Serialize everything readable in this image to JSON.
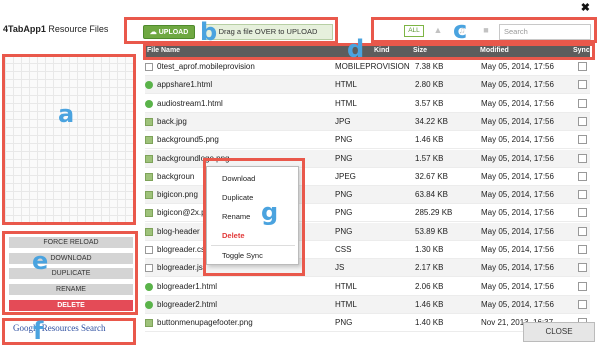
{
  "window": {
    "app_name": "4TabApp1",
    "title_suffix": "Resource Files",
    "close_glyph": "✖"
  },
  "upload": {
    "button_label": "UPLOAD",
    "drop_label": "Drag a file OVER to UPLOAD"
  },
  "filters": {
    "all_label": "ALL",
    "search_placeholder": "Search"
  },
  "table": {
    "columns": {
      "name": "File Name",
      "kind": "Kind",
      "size": "Size",
      "modified": "Modified",
      "sync": "Sync"
    },
    "rows": [
      {
        "icon": "doc",
        "name": "0test_aprof.mobileprovision",
        "kind": "MOBILEPROVISION",
        "size": "7.38 KB",
        "modified": "May 05, 2014, 17:56"
      },
      {
        "icon": "green",
        "name": "appshare1.html",
        "kind": "HTML",
        "size": "2.80 KB",
        "modified": "May 05, 2014, 17:56"
      },
      {
        "icon": "green",
        "name": "audiostream1.html",
        "kind": "HTML",
        "size": "3.57 KB",
        "modified": "May 05, 2014, 17:56"
      },
      {
        "icon": "img",
        "name": "back.jpg",
        "kind": "JPG",
        "size": "34.22 KB",
        "modified": "May 05, 2014, 17:56"
      },
      {
        "icon": "img",
        "name": "background5.png",
        "kind": "PNG",
        "size": "1.46 KB",
        "modified": "May 05, 2014, 17:56"
      },
      {
        "icon": "img",
        "name": "backgroundlogo.png",
        "kind": "PNG",
        "size": "1.57 KB",
        "modified": "May 05, 2014, 17:56"
      },
      {
        "icon": "img",
        "name": "backgroun",
        "kind": "JPEG",
        "size": "32.67 KB",
        "modified": "May 05, 2014, 17:56"
      },
      {
        "icon": "img",
        "name": "bigicon.png",
        "kind": "PNG",
        "size": "63.84 KB",
        "modified": "May 05, 2014, 17:56"
      },
      {
        "icon": "img",
        "name": "bigicon@2x.p",
        "kind": "PNG",
        "size": "285.29 KB",
        "modified": "May 05, 2014, 17:56"
      },
      {
        "icon": "img",
        "name": "blog-header",
        "kind": "PNG",
        "size": "53.89 KB",
        "modified": "May 05, 2014, 17:56"
      },
      {
        "icon": "doc",
        "name": "blogreader.cs",
        "kind": "CSS",
        "size": "1.30 KB",
        "modified": "May 05, 2014, 17:56"
      },
      {
        "icon": "doc",
        "name": "blogreader.js",
        "kind": "JS",
        "size": "2.17 KB",
        "modified": "May 05, 2014, 17:56"
      },
      {
        "icon": "green",
        "name": "blogreader1.html",
        "kind": "HTML",
        "size": "2.06 KB",
        "modified": "May 05, 2014, 17:56"
      },
      {
        "icon": "green",
        "name": "blogreader2.html",
        "kind": "HTML",
        "size": "1.46 KB",
        "modified": "May 05, 2014, 17:56"
      },
      {
        "icon": "img",
        "name": "buttonmenupagefooter.png",
        "kind": "PNG",
        "size": "1.40 KB",
        "modified": "Nov 21, 2013, 16:37"
      }
    ]
  },
  "context_menu": {
    "download": "Download",
    "duplicate": "Duplicate",
    "rename": "Rename",
    "delete": "Delete",
    "toggle_sync": "Toggle Sync"
  },
  "sidebar_actions": {
    "force_reload": "FORCE RELOAD",
    "download": "DOWNLOAD",
    "duplicate": "DUPLICATE",
    "rename": "RENAME",
    "delete": "DELETE"
  },
  "footer": {
    "google_link": "Google Resources Search",
    "close_label": "CLOSE"
  },
  "annotations": {
    "a": "a",
    "b": "b",
    "c": "c",
    "d": "d",
    "e": "e",
    "f": "f",
    "g": "g"
  },
  "colors": {
    "annotation_box": "#e9584b",
    "annotation_letter": "#4aa3df",
    "upload_green": "#6fa842",
    "delete_red": "#e44b57"
  }
}
